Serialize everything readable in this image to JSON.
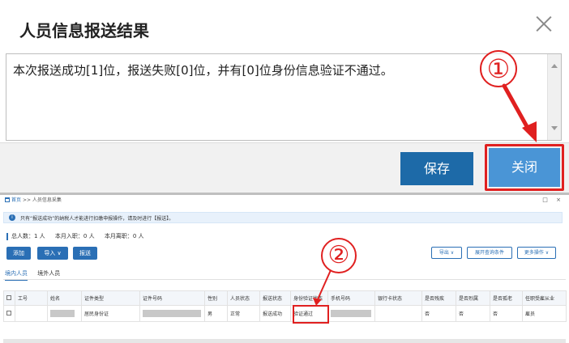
{
  "dialog": {
    "title": "人员信息报送结果",
    "message": "本次报送成功[1]位，报送失败[0]位，并有[0]位身份信息验证不通过。",
    "save_label": "保存",
    "close_label": "关闭"
  },
  "annotations": {
    "marker_1": "①",
    "marker_2": "②"
  },
  "page": {
    "breadcrumb_home": "首页",
    "breadcrumb_sep": ">>",
    "breadcrumb_current": "人员信息采集",
    "window_controls": "□ ×",
    "info_text": "只有“报送成功”的纳税人才能进行扣缴申报操作，请及时进行【报送】。",
    "stats": {
      "total": "总人数：1 人",
      "joined": "本月入职：0 人",
      "left": "本月离职：0 人"
    },
    "buttons": {
      "add": "添加",
      "import": "导入 ∨",
      "submit": "报送",
      "export": "导出 ∨",
      "expand_query": "展开查询条件",
      "more": "更多操作 ∨"
    },
    "tabs": [
      "境内人员",
      "境外人员"
    ],
    "table": {
      "headers": [
        "",
        "工号",
        "姓名",
        "证件类型",
        "证件号码",
        "性别",
        "人员状态",
        "报送状态",
        "身份验证状态",
        "手机号码",
        "银行卡状态",
        "是否残疾",
        "是否烈属",
        "是否孤老",
        "任职受雇从业"
      ],
      "rows": [
        [
          "",
          "",
          "",
          "居民身份证",
          "",
          "男",
          "正常",
          "报送成功",
          "验证通过",
          "",
          "",
          "否",
          "否",
          "否",
          "雇员"
        ]
      ]
    }
  },
  "colors": {
    "primary_blue": "#1d6aa8",
    "close_blue": "#4a95d6",
    "highlight_red": "#e02020"
  }
}
